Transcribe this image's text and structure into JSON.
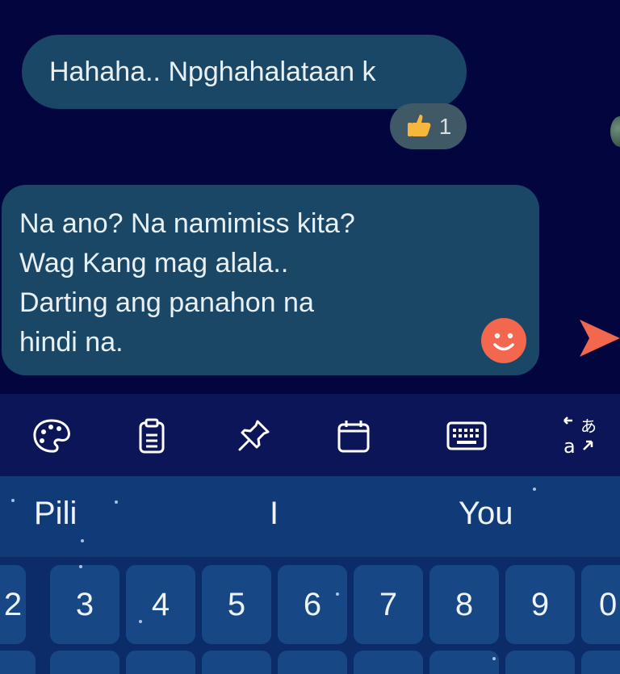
{
  "chat": {
    "received_message": "Hahaha.. Npghahalataan k",
    "reaction": {
      "icon": "thumbs-up-icon",
      "count": "1"
    },
    "compose_lines": [
      "Na ano? Na namimiss kita?",
      "Wag Kang mag alala..",
      "Darting ang panahon na",
      "hindi na."
    ]
  },
  "toolbar": {
    "items": [
      {
        "icon": "palette-icon"
      },
      {
        "icon": "clipboard-icon"
      },
      {
        "icon": "pin-icon"
      },
      {
        "icon": "calendar-icon"
      },
      {
        "icon": "keyboard-icon"
      },
      {
        "icon": "translate-icon"
      }
    ]
  },
  "suggestions": [
    "Pili",
    "I",
    "You"
  ],
  "keyboard": {
    "number_row": [
      "2",
      "3",
      "4",
      "5",
      "6",
      "7",
      "8",
      "9",
      "0"
    ]
  },
  "colors": {
    "background": "#03053f",
    "bubble": "#1b4766",
    "accent": "#f2674d",
    "toolbar": "#0c1557",
    "suggestion_bar": "#113a78",
    "key": "#174885"
  }
}
